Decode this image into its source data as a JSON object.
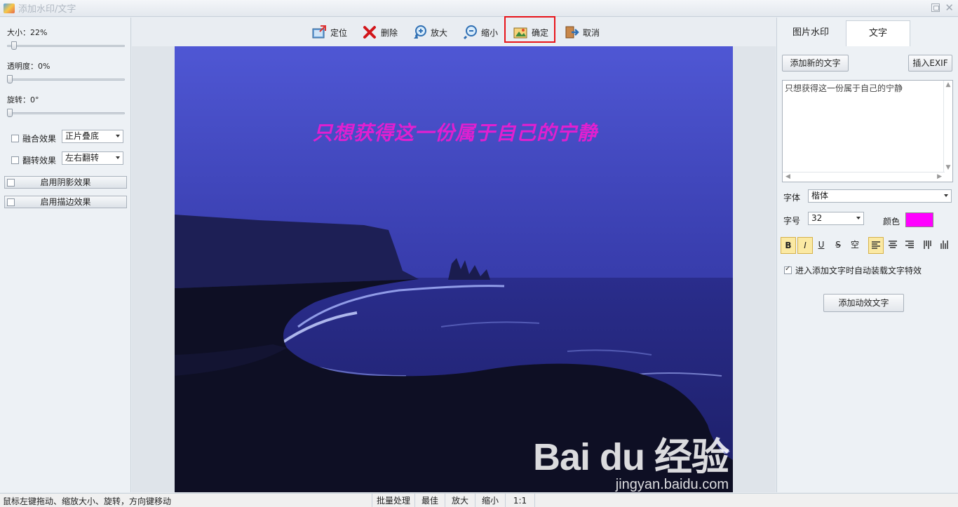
{
  "window": {
    "title": "添加水印/文字"
  },
  "left_panel": {
    "size_label": "大小：22%",
    "size_value": 0.22,
    "opacity_label": "透明度：0%",
    "opacity_value": 0,
    "rotate_label": "旋转：0°",
    "rotate_value": 0,
    "blend": {
      "label": "融合效果",
      "checked": false,
      "selected": "正片叠底"
    },
    "flip": {
      "label": "翻转效果",
      "checked": false,
      "selected": "左右翻转"
    },
    "shadow_button": "启用阴影效果",
    "stroke_button": "启用描边效果"
  },
  "toolbar": {
    "locate": "定位",
    "delete": "删除",
    "zoom_in": "放大",
    "zoom_out": "缩小",
    "confirm": "确定",
    "cancel": "取消"
  },
  "canvas": {
    "overlay_text": "只想获得这一份属于自己的宁静",
    "watermark_main": "Bai du 经验",
    "watermark_sub": "jingyan.baidu.com"
  },
  "right_panel": {
    "tabs": [
      {
        "label": "图片水印"
      },
      {
        "label": "文字"
      }
    ],
    "active_tab": "文字",
    "add_text_button": "添加新的文字",
    "insert_exif_button": "插入EXIF",
    "text_content": "只想获得这一份属于自己的宁静",
    "font_label": "字体",
    "font_value": "楷体",
    "size_label": "字号",
    "size_value": "32",
    "color_label": "颜色",
    "color_value": "#ff00ff",
    "format_buttons": [
      {
        "label": "B",
        "icon": "bold-icon",
        "active": true
      },
      {
        "label": "I",
        "icon": "italic-icon",
        "active": true
      },
      {
        "label": "U",
        "icon": "underline-icon",
        "active": false
      },
      {
        "label": "S",
        "icon": "strikethrough-icon",
        "active": false
      },
      {
        "label": "空",
        "icon": "hollow-icon",
        "active": false
      }
    ],
    "align_buttons": [
      {
        "icon": "align-left-icon",
        "active": true
      },
      {
        "icon": "align-center-icon",
        "active": false
      },
      {
        "icon": "align-right-icon",
        "active": false
      },
      {
        "icon": "vertical-text-icon",
        "active": false
      },
      {
        "icon": "vertical-text-right-icon",
        "active": false
      }
    ],
    "auto_effect_label": "进入添加文字时自动装载文字特效",
    "auto_effect_checked": true,
    "animated_text_button": "添加动效文字"
  },
  "statusbar": {
    "hint": "鼠标左键拖动、缩放大小、旋转，方向键移动",
    "batch": "批量处理",
    "best": "最佳",
    "zoom_in": "放大",
    "zoom_out": "缩小",
    "ratio": "1:1"
  },
  "colors": {
    "highlight": "#e8141a",
    "overlay_text": "#e020d0"
  }
}
